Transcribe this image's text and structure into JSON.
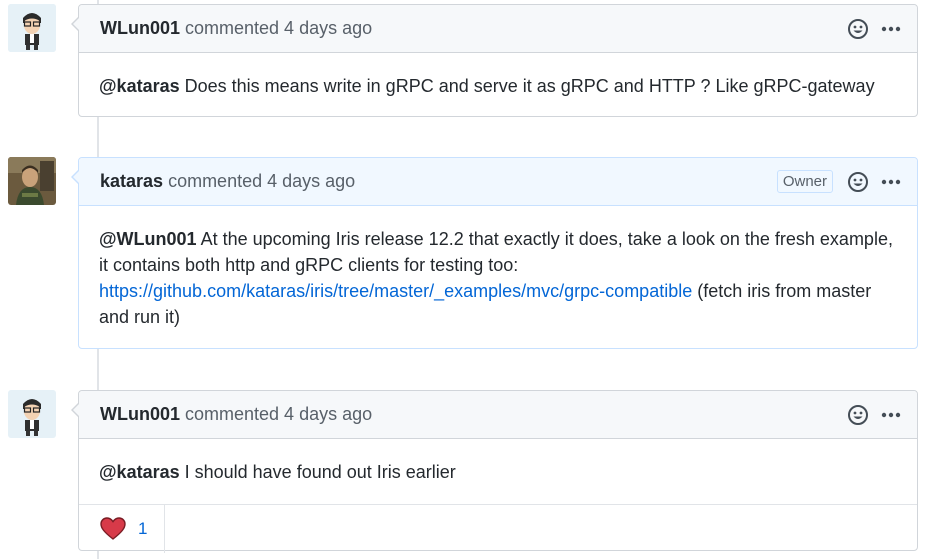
{
  "comments": [
    {
      "author": "WLun001",
      "meta": "commented 4 days ago",
      "owner_badge": "",
      "mention": "@kataras",
      "text": " Does this means write in gRPC and serve it as gRPC and HTTP ? Like gRPC-gateway"
    },
    {
      "author": "kataras",
      "meta": "commented 4 days ago",
      "owner_badge": "Owner",
      "mention": "@WLun001",
      "text": " At the upcoming Iris release 12.2 that exactly it does, take a look on the fresh example, it contains both http and gRPC clients for testing too:",
      "link": "https://github.com/kataras/iris/tree/master/_examples/mvc/grpc-compatible",
      "text_after": " (fetch iris from master and run it)"
    },
    {
      "author": "WLun001",
      "meta": "commented 4 days ago",
      "owner_badge": "",
      "mention": "@kataras",
      "text": " I should have found out Iris earlier",
      "reactions": [
        {
          "icon": "heart-icon",
          "count": "1"
        }
      ]
    }
  ],
  "icons": {
    "add_reaction": "smiley-icon",
    "menu": "kebab-icon"
  },
  "colors": {
    "link": "#0366d6",
    "owner_header": "#f1f8ff",
    "heart": "#d73a49"
  }
}
